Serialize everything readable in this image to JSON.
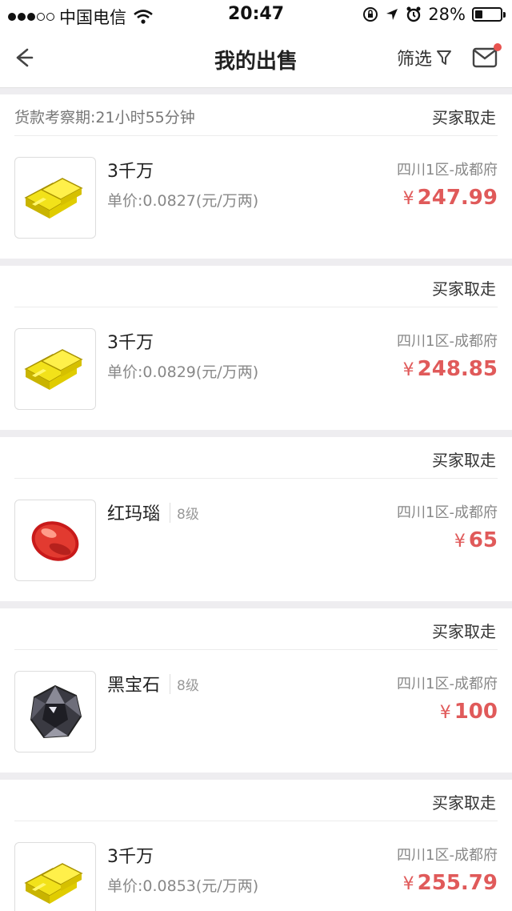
{
  "status_bar": {
    "carrier": "中国电信",
    "time": "20:47",
    "battery": "28%"
  },
  "nav": {
    "title": "我的出售",
    "filter_label": "筛选"
  },
  "orders": [
    {
      "period": "货款考察期:21小时55分钟",
      "status": "买家取走",
      "item_type": "gold-bars",
      "name": "3千万",
      "level": "",
      "unit_price": "单价:0.0827(元/万两)",
      "server": "四川1区-成都府",
      "price": "247.99"
    },
    {
      "period": "",
      "status": "买家取走",
      "item_type": "gold-bars",
      "name": "3千万",
      "level": "",
      "unit_price": "单价:0.0829(元/万两)",
      "server": "四川1区-成都府",
      "price": "248.85"
    },
    {
      "period": "",
      "status": "买家取走",
      "item_type": "red-agate-gem",
      "name": "红玛瑙",
      "level": "8级",
      "unit_price": "",
      "server": "四川1区-成都府",
      "price": "65"
    },
    {
      "period": "",
      "status": "买家取走",
      "item_type": "black-gem",
      "name": "黑宝石",
      "level": "8级",
      "unit_price": "",
      "server": "四川1区-成都府",
      "price": "100"
    },
    {
      "period": "",
      "status": "买家取走",
      "item_type": "gold-bars",
      "name": "3千万",
      "level": "",
      "unit_price": "单价:0.0853(元/万两)",
      "server": "四川1区-成都府",
      "price": "255.79"
    }
  ],
  "currency_symbol": "¥",
  "colors": {
    "price": "#e05a5a",
    "notification_dot": "#e8534f"
  }
}
